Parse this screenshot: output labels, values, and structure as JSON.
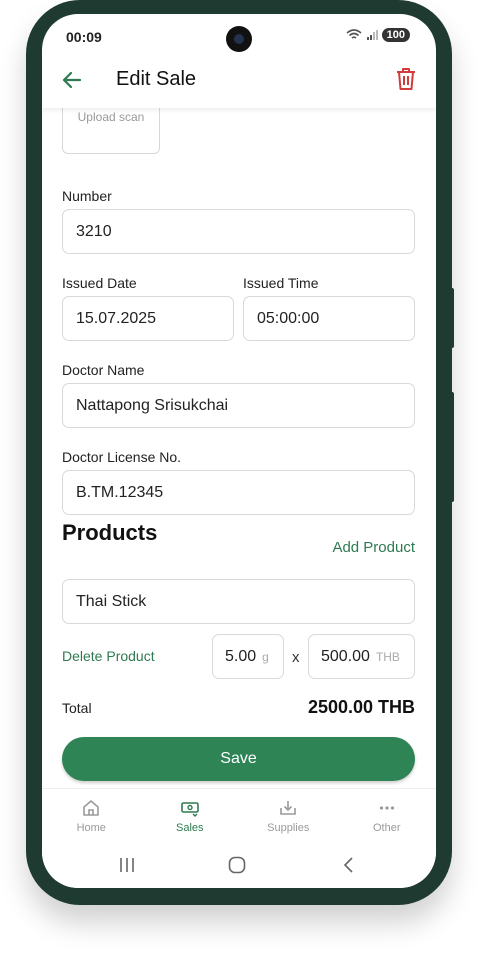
{
  "status_bar": {
    "time": "00:09",
    "battery": "100"
  },
  "header": {
    "title": "Edit Sale"
  },
  "form": {
    "upload_label": "Upload scan",
    "number_label": "Number",
    "number_value": "3210",
    "issued_date_label": "Issued Date",
    "issued_date_value": "15.07.2025",
    "issued_time_label": "Issued Time",
    "issued_time_value": "05:00:00",
    "doctor_name_label": "Doctor Name",
    "doctor_name_value": "Nattapong Srisukchai",
    "doctor_license_label": "Doctor License No.",
    "doctor_license_value": "B.TM.12345"
  },
  "products": {
    "heading": "Products",
    "add_label": "Add Product",
    "items": [
      {
        "name": "Thai Stick",
        "delete_label": "Delete Product",
        "quantity": "5.00",
        "quantity_unit": "g",
        "multiplier": "x",
        "price": "500.00",
        "currency": "THB"
      }
    ]
  },
  "total": {
    "label": "Total",
    "value": "2500.00 THB"
  },
  "save_label": "Save",
  "bottom_nav": [
    {
      "label": "Home",
      "icon": "home-icon",
      "active": false
    },
    {
      "label": "Sales",
      "icon": "cash-icon",
      "active": true
    },
    {
      "label": "Supplies",
      "icon": "download-icon",
      "active": false
    },
    {
      "label": "Other",
      "icon": "more-icon",
      "active": false
    }
  ],
  "colors": {
    "accent": "#2f8456",
    "link": "#2f7a51",
    "danger": "#d23b3b",
    "frame": "#1f3a31"
  }
}
